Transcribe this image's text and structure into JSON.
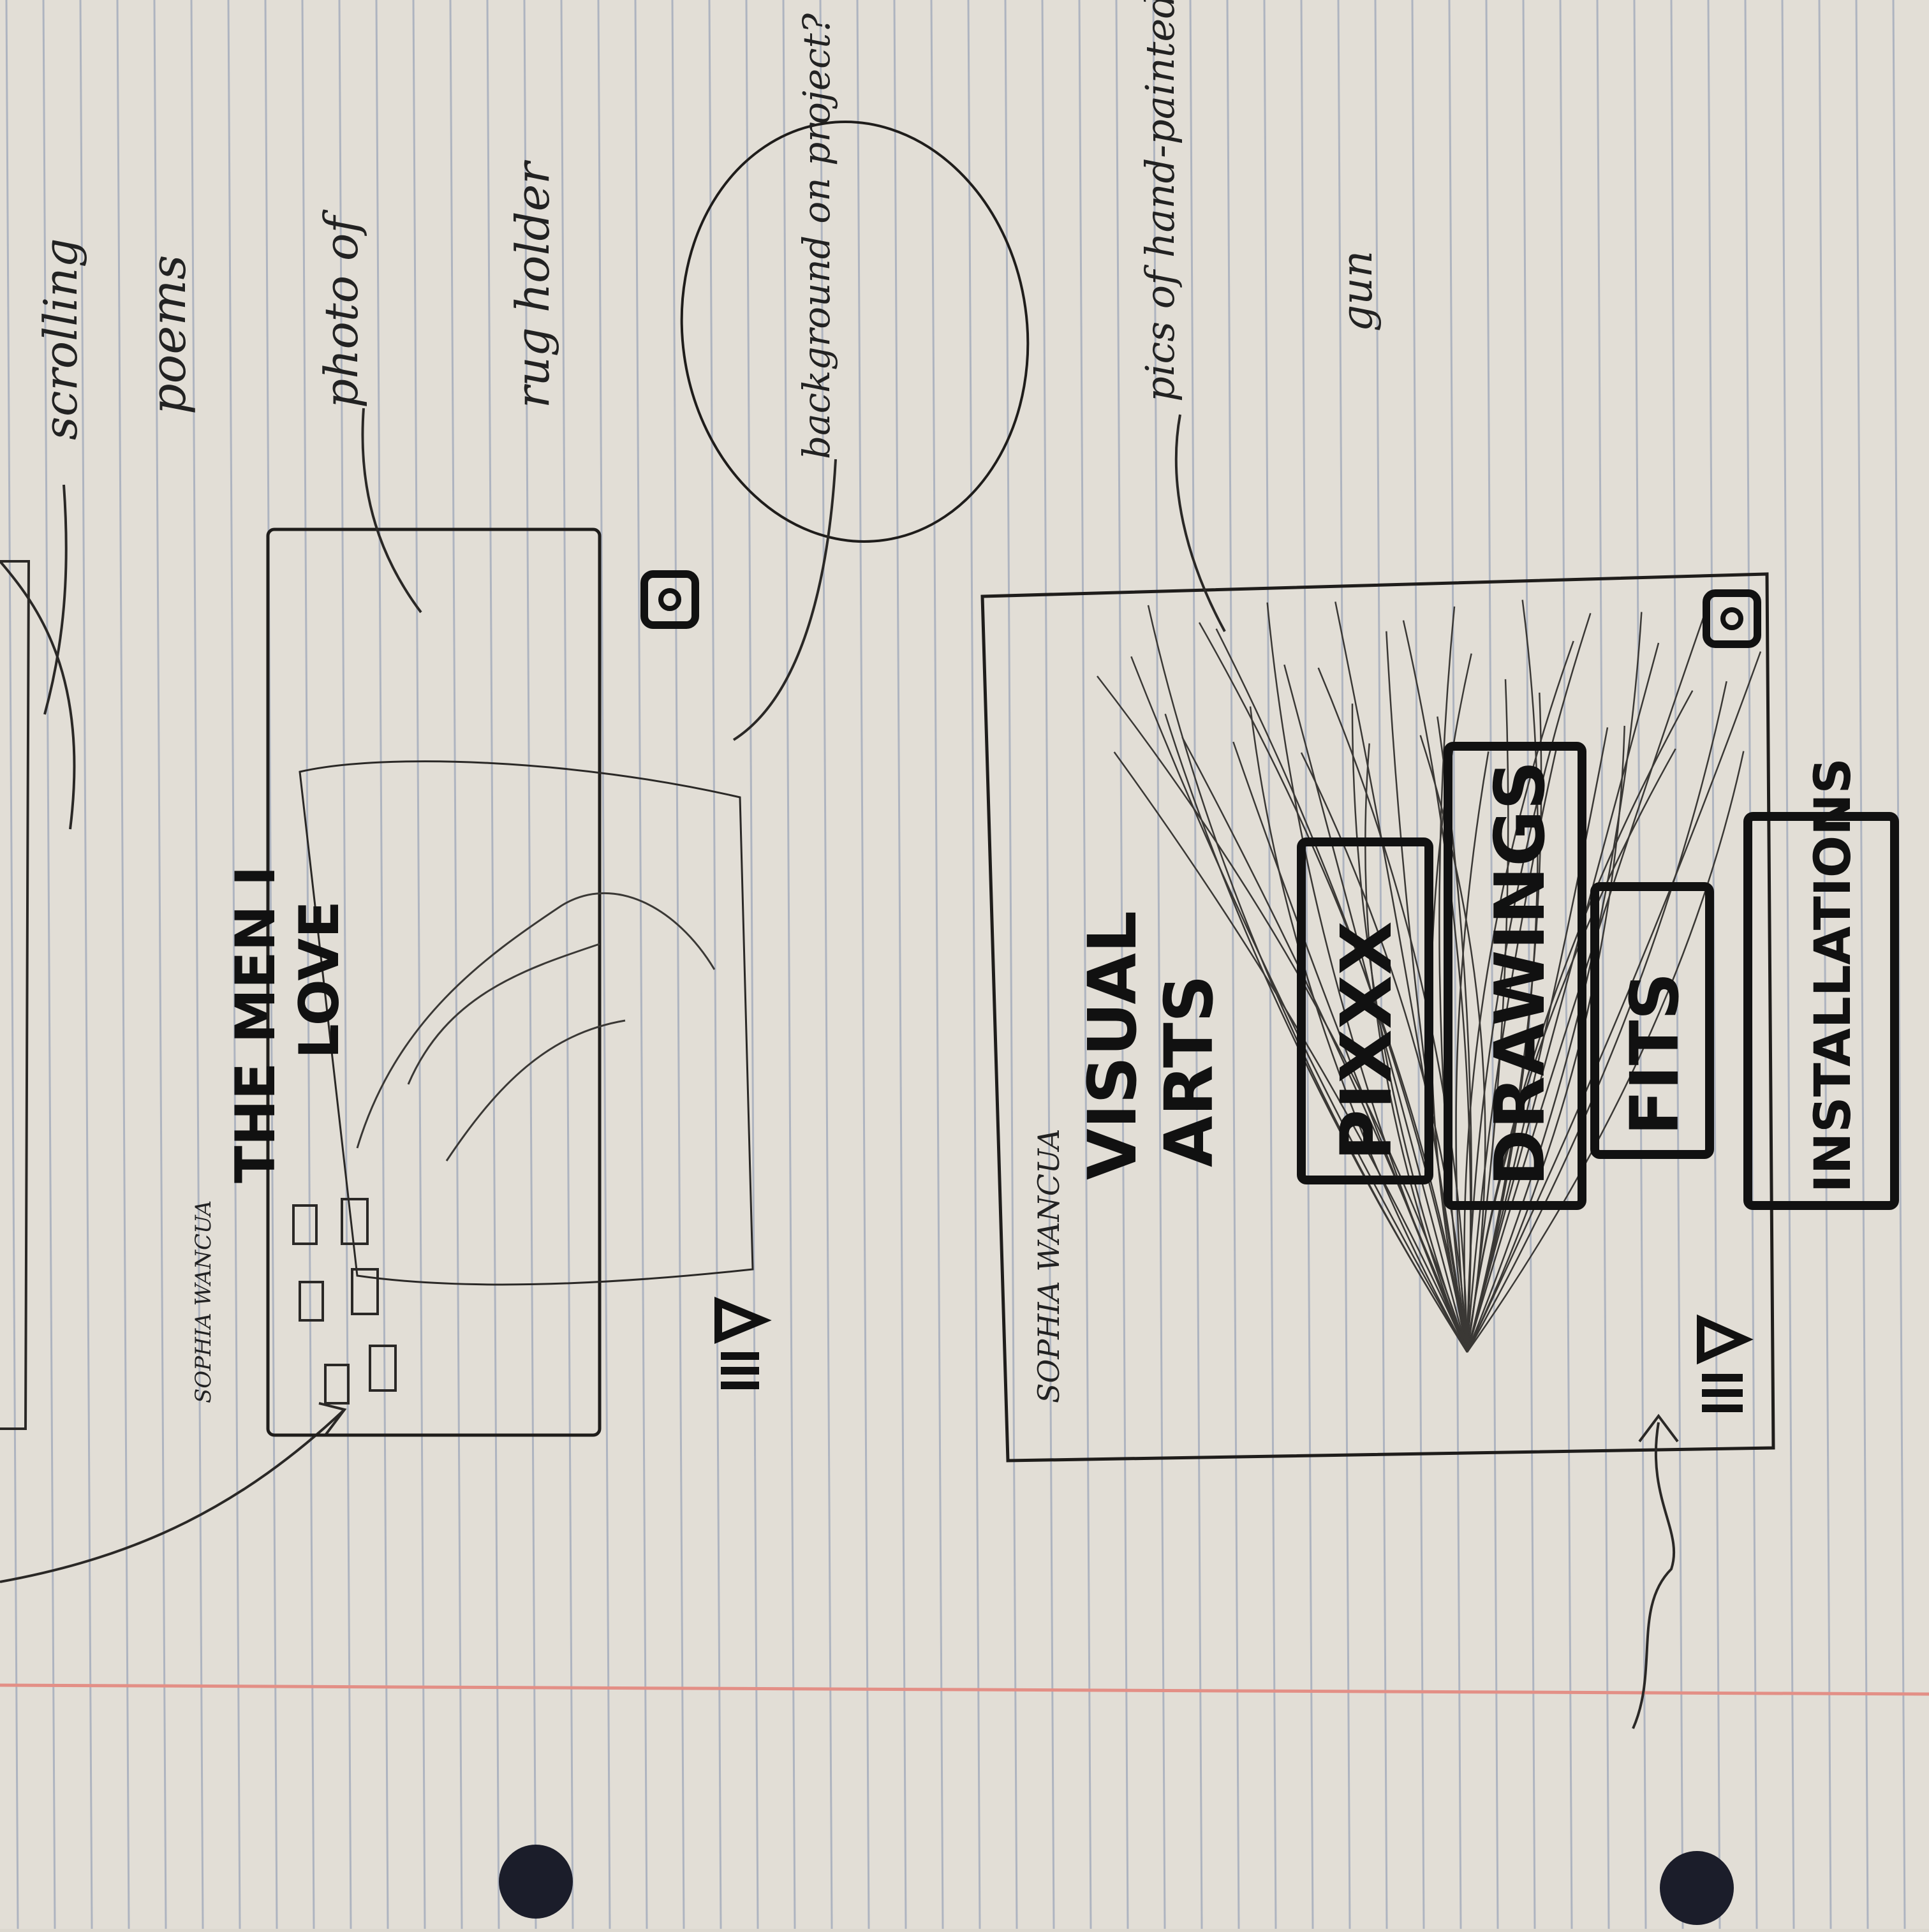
{
  "paper": {
    "background": "#e2ded6",
    "rule_color": "#aeb4c0",
    "margin_color": "#e38f86",
    "ink": "#1f1d1b"
  },
  "sketch_one": {
    "brand": "SOPHIA WANCUA",
    "title_line1": "THE MEN I",
    "title_line2": "LOVE",
    "icons": [
      "instagram-icon",
      "menu-icon",
      "play-icon"
    ]
  },
  "sketch_two": {
    "brand": "SOPHIA WANCUA",
    "title_line1": "VISUAL",
    "title_line2": "ARTS",
    "buttons": [
      "PIXXX",
      "DRAWINGS",
      "FITS",
      "INSTALLATIONS"
    ],
    "icons": [
      "instagram-icon",
      "menu-icon",
      "play-icon"
    ]
  },
  "notes": {
    "scrolling": "scrolling",
    "poems": "poems",
    "photo": "photo of",
    "rug": "rug holder",
    "background": "background on project?",
    "pics": "pics of hand-painted merch",
    "gun": "gun"
  }
}
